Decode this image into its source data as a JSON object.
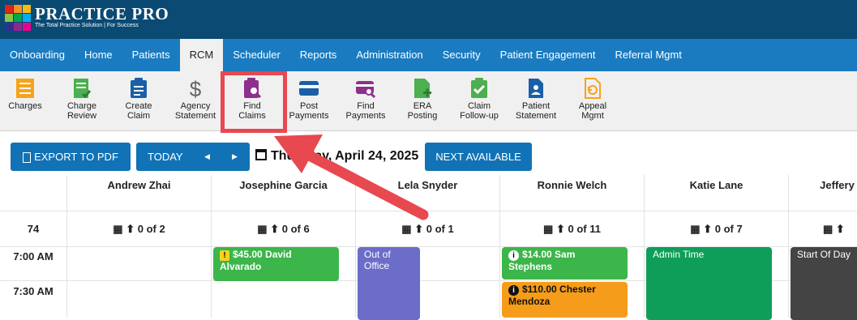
{
  "app": {
    "name": "PRACTICE PRO",
    "tagline": "The Total Practice Solution | For Success",
    "logo_colors": [
      "#e2231a",
      "#f7941d",
      "#fdb913",
      "#8dc63f",
      "#00a651",
      "#00aeef",
      "#2e3192",
      "#92278f",
      "#ec008c"
    ]
  },
  "nav": [
    {
      "label": "Onboarding",
      "active": false
    },
    {
      "label": "Home",
      "active": false
    },
    {
      "label": "Patients",
      "active": false
    },
    {
      "label": "RCM",
      "active": true
    },
    {
      "label": "Scheduler",
      "active": false
    },
    {
      "label": "Reports",
      "active": false
    },
    {
      "label": "Administration",
      "active": false
    },
    {
      "label": "Security",
      "active": false
    },
    {
      "label": "Patient Engagement",
      "active": false
    },
    {
      "label": "Referral Mgmt",
      "active": false
    }
  ],
  "toolbar": [
    {
      "line1": "Charges",
      "line2": "",
      "icon": "charges-icon",
      "color": "#f7a21b"
    },
    {
      "line1": "Charge",
      "line2": "Review",
      "icon": "charge-review-icon",
      "color": "#4caf50"
    },
    {
      "line1": "Create",
      "line2": "Claim",
      "icon": "create-claim-icon",
      "color": "#1a5fa8"
    },
    {
      "line1": "Agency",
      "line2": "Statement",
      "icon": "dollar-icon",
      "color": "#666666"
    },
    {
      "line1": "Find",
      "line2": "Claims",
      "icon": "find-claims-icon",
      "color": "#8e2f8e"
    },
    {
      "line1": "Post",
      "line2": "Payments",
      "icon": "post-payments-icon",
      "color": "#1a5fa8"
    },
    {
      "line1": "Find",
      "line2": "Payments",
      "icon": "find-payments-icon",
      "color": "#8e2f8e"
    },
    {
      "line1": "ERA",
      "line2": "Posting",
      "icon": "era-posting-icon",
      "color": "#4caf50"
    },
    {
      "line1": "Claim",
      "line2": "Follow-up",
      "icon": "claim-followup-icon",
      "color": "#4caf50"
    },
    {
      "line1": "Patient",
      "line2": "Statement",
      "icon": "patient-statement-icon",
      "color": "#1a5fa8"
    },
    {
      "line1": "Appeal",
      "line2": "Mgmt",
      "icon": "appeal-icon",
      "color": "#f7a21b"
    }
  ],
  "controls": {
    "export": "EXPORT TO PDF",
    "today": "TODAY",
    "prev": "◀",
    "next": "▶",
    "date": "Thursday, April 24, 2025",
    "next_available": "NEXT AVAILABLE"
  },
  "providers": [
    {
      "name": "Andrew Zhai",
      "count": "0 of 2"
    },
    {
      "name": "Josephine Garcia",
      "count": "0 of 6"
    },
    {
      "name": "Lela Snyder",
      "count": "0 of 1"
    },
    {
      "name": "Ronnie Welch",
      "count": "0 of 11"
    },
    {
      "name": "Katie Lane",
      "count": "0 of 7"
    },
    {
      "name": "Jeffery",
      "count": ""
    }
  ],
  "row_number": "74",
  "times": [
    "7:00 AM",
    "7:30 AM"
  ],
  "appointments": [
    {
      "text": "$45.00 David Alvarado",
      "color": "#3cb54a",
      "badge": "warn"
    },
    {
      "text": "Out of Office",
      "color": "#6c6cc9",
      "badge": ""
    },
    {
      "text": "$14.00 Sam Stephens",
      "color": "#3cb54a",
      "badge": "info"
    },
    {
      "text": "$110.00 Chester Mendoza",
      "color": "#f59c1a",
      "badge": "info"
    },
    {
      "text": "Admin Time",
      "color": "#0f9e5a",
      "badge": ""
    },
    {
      "text": "Start Of Day",
      "color": "#444444",
      "badge": ""
    }
  ],
  "accent": "#e8484f"
}
